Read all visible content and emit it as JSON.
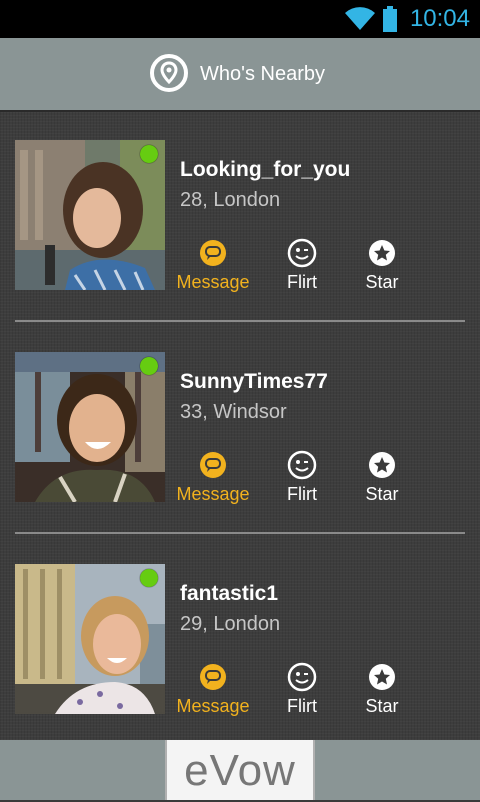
{
  "status_bar": {
    "time": "10:04",
    "wifi_icon": "wifi-icon",
    "battery_icon": "battery-icon",
    "accent": "#33b5e5"
  },
  "header": {
    "title": "Who's Nearby",
    "icon": "location-pin-icon"
  },
  "profiles": [
    {
      "username": "Looking_for_you",
      "details": "28, London",
      "online": true
    },
    {
      "username": "SunnyTimes77",
      "details": "33, Windsor",
      "online": true
    },
    {
      "username": "fantastic1",
      "details": "29, London",
      "online": true
    }
  ],
  "actions": {
    "message": "Message",
    "flirt": "Flirt",
    "star": "Star"
  },
  "colors": {
    "online": "#66cc11",
    "message_accent": "#f2b21e",
    "header_bg": "#8a9595"
  },
  "footer": {
    "logo": "eVow"
  }
}
